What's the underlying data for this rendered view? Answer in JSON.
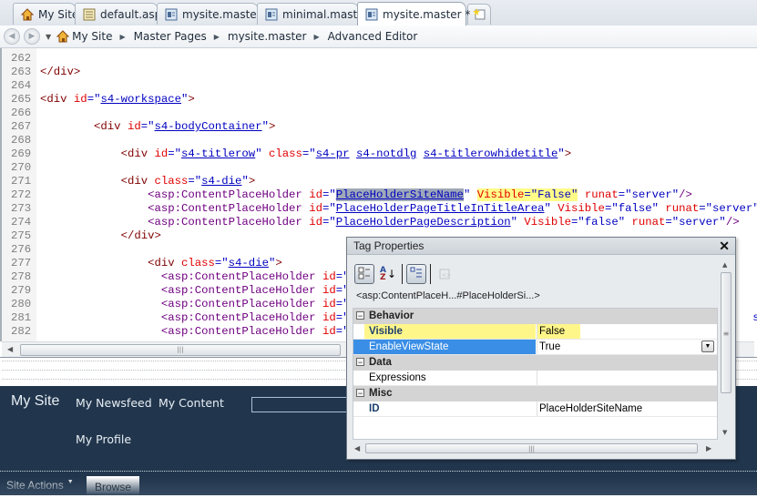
{
  "tabs": [
    {
      "label": "My Site",
      "icon": "home-icon",
      "active": false
    },
    {
      "label": "default.aspx",
      "icon": "aspx-page-icon",
      "active": false
    },
    {
      "label": "mysite.master",
      "icon": "master-page-icon",
      "active": false
    },
    {
      "label": "minimal.master",
      "icon": "master-page-icon",
      "active": false
    },
    {
      "label": "mysite.master *",
      "icon": "master-page-icon",
      "active": true
    }
  ],
  "breadcrumb": [
    "My Site",
    "Master Pages",
    "mysite.master",
    "Advanced Editor"
  ],
  "code_lines": [
    {
      "n": "262",
      "html": ""
    },
    {
      "n": "263",
      "html": "<span class='t'>&lt;/div&gt;</span>"
    },
    {
      "n": "264",
      "html": ""
    },
    {
      "n": "265",
      "html": "<span class='t'>&lt;div</span> <span class='a'>id</span><span class='q'>=\"</span><span class='v'>s4-workspace</span><span class='q'>\"</span><span class='t'>&gt;</span>"
    },
    {
      "n": "266",
      "html": ""
    },
    {
      "n": "267",
      "html": "        <span class='t'>&lt;div</span> <span class='a'>id</span><span class='q'>=\"</span><span class='v'>s4-bodyContainer</span><span class='q'>\"</span><span class='t'>&gt;</span>"
    },
    {
      "n": "268",
      "html": ""
    },
    {
      "n": "269",
      "html": "            <span class='t'>&lt;div</span> <span class='a'>id</span><span class='q'>=\"</span><span class='v'>s4-titlerow</span><span class='q'>\"</span> <span class='a'>class</span><span class='q'>=\"</span><span class='v'>s4-pr</span> <span class='v'>s4-notdlg</span> <span class='v'>s4-titlerowhidetitle</span><span class='q'>\"</span><span class='t'>&gt;</span>"
    },
    {
      "n": "270",
      "html": ""
    },
    {
      "n": "271",
      "html": "            <span class='t'>&lt;div</span> <span class='a'>class</span><span class='q'>=\"</span><span class='v'>s4-die</span><span class='q'>\"</span><span class='t'>&gt;</span>"
    },
    {
      "n": "272",
      "html": "                <span class='tn'>&lt;asp:ContentPlaceHolder</span> <span class='a'>id</span><span class='q'>=\"</span><span class='v sel'>PlaceHolderSiteName</span><span class='q'>\"</span> <span class='hl'><span class='a'>Visible</span><span class='q'>=\"False\"</span></span> <span class='a'>runat</span><span class='q'>=\"server\"</span><span class='tn'>/&gt;</span>"
    },
    {
      "n": "273",
      "html": "                <span class='tn'>&lt;asp:ContentPlaceHolder</span> <span class='a'>id</span><span class='q'>=\"</span><span class='v'>PlaceHolderPageTitleInTitleArea</span><span class='q'>\"</span> <span class='a'>Visible</span><span class='q'>=\"false\"</span> <span class='a'>runat</span><span class='q'>=\"server\"</span> <span class='tn'>/&gt;</span>"
    },
    {
      "n": "274",
      "html": "                <span class='tn'>&lt;asp:ContentPlaceHolder</span> <span class='a'>id</span><span class='q'>=\"</span><span class='v'>PlaceHolderPageDescription</span><span class='q'>\"</span> <span class='a'>Visible</span><span class='q'>=\"false\"</span> <span class='a'>runat</span><span class='q'>=\"server\"</span><span class='tn'>/&gt;</span>"
    },
    {
      "n": "275",
      "html": "            <span class='t'>&lt;/div&gt;</span>"
    },
    {
      "n": "276",
      "html": ""
    },
    {
      "n": "277",
      "html": "                <span class='t'>&lt;div</span> <span class='a'>class</span><span class='q'>=\"</span><span class='v'>s4-die</span><span class='q'>\"</span><span class='t'>&gt;</span>"
    },
    {
      "n": "278",
      "html": "                  <span class='tn'>&lt;asp:ContentPlaceHolder</span> <span class='a'>id</span><span class='q'>=\"</span><span class='v'>Pl</span>"
    },
    {
      "n": "279",
      "html": "                  <span class='tn'>&lt;asp:ContentPlaceHolder</span> <span class='a'>id</span><span class='q'>=\"</span><span class='v'>Pl</span>"
    },
    {
      "n": "280",
      "html": "                  <span class='tn'>&lt;asp:ContentPlaceHolder</span> <span class='a'>id</span><span class='q'>=\"</span><span class='v'>Pl</span>"
    },
    {
      "n": "281",
      "html": "                  <span class='tn'>&lt;asp:ContentPlaceHolder</span> <span class='a'>id</span><span class='q'>=\"</span><span class='v'>Pl</span>                                                          <span class='q'>se\"</span>"
    },
    {
      "n": "282",
      "html": "                  <span class='tn'>&lt;asp:ContentPlaceHolder</span> <span class='a'>id</span><span class='q'>=\"</span><span class='v'>Pl</span>"
    }
  ],
  "design": {
    "site_name": "My Site",
    "nav": [
      "My Newsfeed",
      "My Content",
      "My Profile"
    ],
    "site_actions": "Site Actions",
    "browse_tab": "Browse"
  },
  "panel": {
    "title": "Tag Properties",
    "tag_path": "<asp:ContentPlaceH...#PlaceHolderSi...>",
    "toolbar": [
      "categorized-icon",
      "alphabetical-icon",
      "show-set-properties-icon",
      "tag-properties-icon"
    ],
    "categories": [
      {
        "name": "Behavior",
        "props": [
          {
            "name": "Visible",
            "value": "False",
            "bold": true,
            "highlight": true
          },
          {
            "name": "EnableViewState",
            "value": "True",
            "selected": true,
            "dropdown": true
          }
        ]
      },
      {
        "name": "Data",
        "props": [
          {
            "name": "Expressions",
            "value": ""
          }
        ]
      },
      {
        "name": "Misc",
        "props": [
          {
            "name": "ID",
            "value": "PlaceHolderSiteName",
            "bold": true
          }
        ]
      }
    ]
  }
}
